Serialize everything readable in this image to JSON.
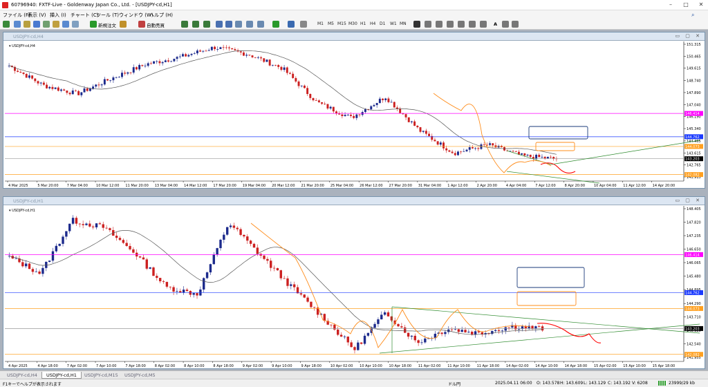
{
  "window": {
    "title": "60796940: FXTF-Live - Goldenway Japan Co., Ltd. - [USDJPY-cd,H1]"
  },
  "menu": [
    "ファイル (F)",
    "表示 (V)",
    "挿入 (I)",
    "チャート (C)",
    "ツール (T)",
    "ウィンドウ (W)",
    "ヘルプ (H)"
  ],
  "toolbar": {
    "new_order": "新規注文",
    "auto_trade": "自動売買",
    "timeframes": [
      "M1",
      "M5",
      "M15",
      "M30",
      "H1",
      "H4",
      "D1",
      "W1",
      "MN"
    ]
  },
  "charts": [
    {
      "window_title": "USDJPY-cd,H4",
      "label": "USDJPY-cd,H4",
      "y_ticks": [
        "151.315",
        "150.465",
        "149.615",
        "148.740",
        "147.890",
        "147.040",
        "146.190",
        "145.340",
        "144.465",
        "143.615",
        "142.765",
        "141.915"
      ],
      "markers": [
        {
          "value": "146.414",
          "color": "#ff00ff"
        },
        {
          "value": "144.762",
          "color": "#1a3aff"
        },
        {
          "value": "144.073",
          "color": "#ffa020"
        },
        {
          "value": "143.203",
          "color": "#000000"
        },
        {
          "value": "142.082",
          "color": "#ffa020"
        }
      ],
      "x_ticks": [
        "4 Mar 2025",
        "5 Mar 20:00",
        "7 Mar 04:00",
        "10 Mar 12:00",
        "11 Mar 20:00",
        "13 Mar 04:00",
        "14 Mar 12:00",
        "17 Mar 20:00",
        "19 Mar 04:00",
        "20 Mar 12:00",
        "21 Mar 20:00",
        "25 Mar 04:00",
        "26 Mar 12:00",
        "27 Mar 20:00",
        "31 Mar 04:00",
        "1 Apr 12:00",
        "2 Apr 20:00",
        "4 Apr 04:00",
        "7 Apr 12:00",
        "8 Apr 20:00",
        "10 Apr 04:00",
        "11 Apr 12:00",
        "14 Apr 20:00"
      ]
    },
    {
      "window_title": "USDJPY-cd,H1",
      "label": "USDJPY-cd,H1",
      "y_ticks": [
        "148.405",
        "147.820",
        "147.235",
        "146.650",
        "146.065",
        "145.480",
        "144.895",
        "144.290",
        "143.710",
        "143.125",
        "142.540",
        "141.955"
      ],
      "markers": [
        {
          "value": "146.414",
          "color": "#ff00ff"
        },
        {
          "value": "144.762",
          "color": "#1a3aff"
        },
        {
          "value": "144.073",
          "color": "#ffa020"
        },
        {
          "value": "143.203",
          "color": "#000000"
        },
        {
          "value": "142.082",
          "color": "#ffa020"
        }
      ],
      "x_ticks": [
        "4 Apr 2025",
        "4 Apr 18:00",
        "7 Apr 02:00",
        "7 Apr 10:00",
        "7 Apr 18:00",
        "8 Apr 02:00",
        "8 Apr 10:00",
        "8 Apr 18:00",
        "9 Apr 02:00",
        "9 Apr 10:00",
        "9 Apr 18:00",
        "10 Apr 02:00",
        "10 Apr 10:00",
        "10 Apr 18:00",
        "11 Apr 02:00",
        "11 Apr 10:00",
        "11 Apr 18:00",
        "14 Apr 02:00",
        "14 Apr 10:00",
        "14 Apr 18:00",
        "15 Apr 02:00",
        "15 Apr 10:00",
        "15 Apr 18:00"
      ]
    }
  ],
  "tabs": [
    "USDJPY-cd,H4",
    "USDJPY-cd,H1",
    "USDJPY-cd,M15",
    "USDJPY-cd,M5"
  ],
  "active_tab": 1,
  "status": {
    "help": "F1キーでヘルプが表示されます",
    "profile": "ドル円",
    "datetime": "2025.04.11 06:00",
    "open": "O: 143.578",
    "high": "H: 143.609",
    "low": "L: 143.129",
    "close": "C: 143.192",
    "volume": "V: 6208",
    "traffic": "23999/29 kb"
  },
  "colors": {
    "bull": "#1c2a8c",
    "bear": "#cc2020",
    "ma": "#555555",
    "fractal": "#ff8c1a",
    "trend": "#2e8b2e",
    "forecast": "#ff0000"
  }
}
